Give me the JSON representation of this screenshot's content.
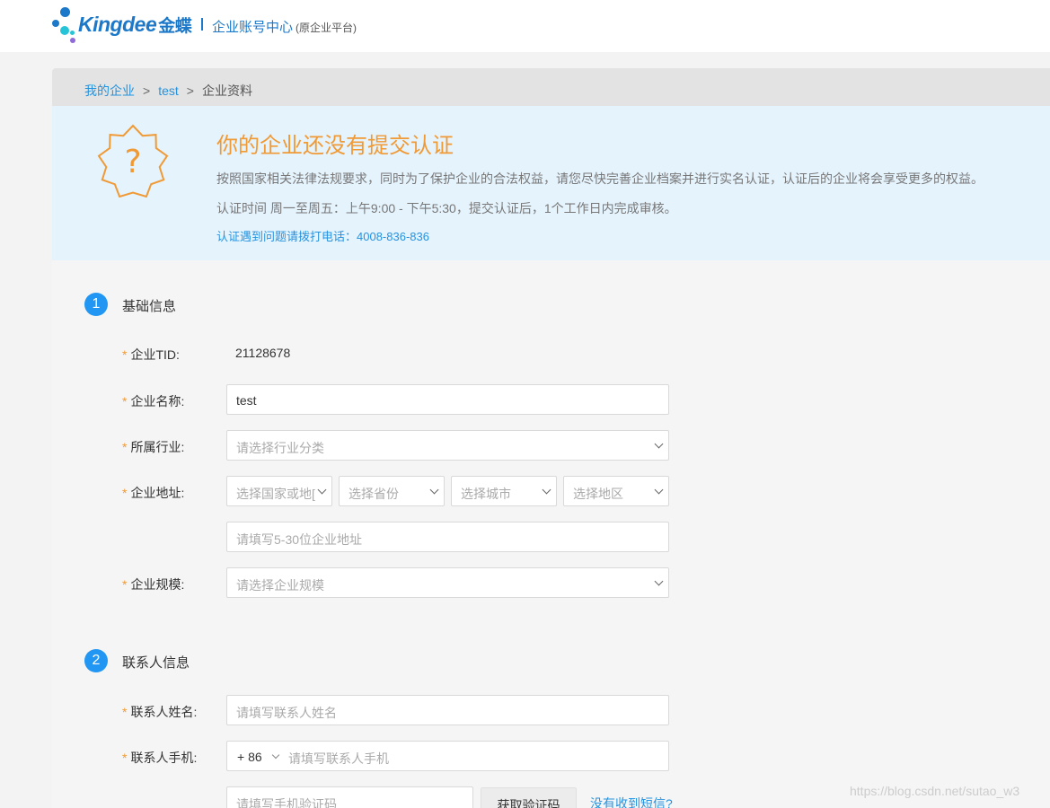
{
  "header": {
    "brand": "Kingdee",
    "brand_cn": "金蝶",
    "title": "企业账号中心",
    "subtitle": "(原企业平台)"
  },
  "breadcrumb": {
    "items": [
      "我的企业",
      "test"
    ],
    "current": "企业资料",
    "separator": ">"
  },
  "notice": {
    "icon": "question-mark-icon",
    "title": "你的企业还没有提交认证",
    "line1": "按照国家相关法律法规要求，同时为了保护企业的合法权益，请您尽快完善企业档案并进行实名认证，认证后的企业将会享受更多的权益。",
    "line2": "认证时间 周一至周五：上午9:00 - 下午5:30，提交认证后，1个工作日内完成审核。",
    "hotline": "认证遇到问题请拨打电话：4008-836-836"
  },
  "section1": {
    "number": "1",
    "title": "基础信息",
    "tid_label": "企业TID:",
    "tid_value": "21128678",
    "name_label": "企业名称:",
    "name_value": "test",
    "industry_label": "所属行业:",
    "industry_placeholder": "请选择行业分类",
    "address_label": "企业地址:",
    "country_placeholder": "选择国家或地[",
    "province_placeholder": "选择省份",
    "city_placeholder": "选择城市",
    "district_placeholder": "选择地区",
    "street_placeholder": "请填写5-30位企业地址",
    "scale_label": "企业规模:",
    "scale_placeholder": "请选择企业规模"
  },
  "section2": {
    "number": "2",
    "title": "联系人信息",
    "contact_name_label": "联系人姓名:",
    "contact_name_placeholder": "请填写联系人姓名",
    "contact_phone_label": "联系人手机:",
    "country_code": "+ 86",
    "phone_placeholder": "请填写联系人手机",
    "code_placeholder": "请填写手机验证码",
    "get_code_label": "获取验证码",
    "no_sms_label": "没有收到短信?"
  },
  "required_mark": "*",
  "watermark": "https://blog.csdn.net/sutao_w3",
  "colors": {
    "accent": "#2196f3",
    "link": "#2693df",
    "warning": "#f09a36",
    "notice_bg": "#e5f3fd"
  }
}
